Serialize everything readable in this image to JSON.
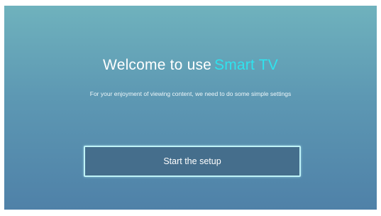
{
  "welcome": {
    "title_prefix": "Welcome to use",
    "brand": "Smart TV",
    "brand_color": "#2fe3ee",
    "subtitle": "For your enjoyment of viewing content, we need to do some simple settings"
  },
  "actions": {
    "start_label": "Start the setup"
  },
  "colors": {
    "background_top": "#6fb2bd",
    "background_bottom": "#4f81a8",
    "button_fill": "#456e8c",
    "button_border": "#bff3f7"
  }
}
